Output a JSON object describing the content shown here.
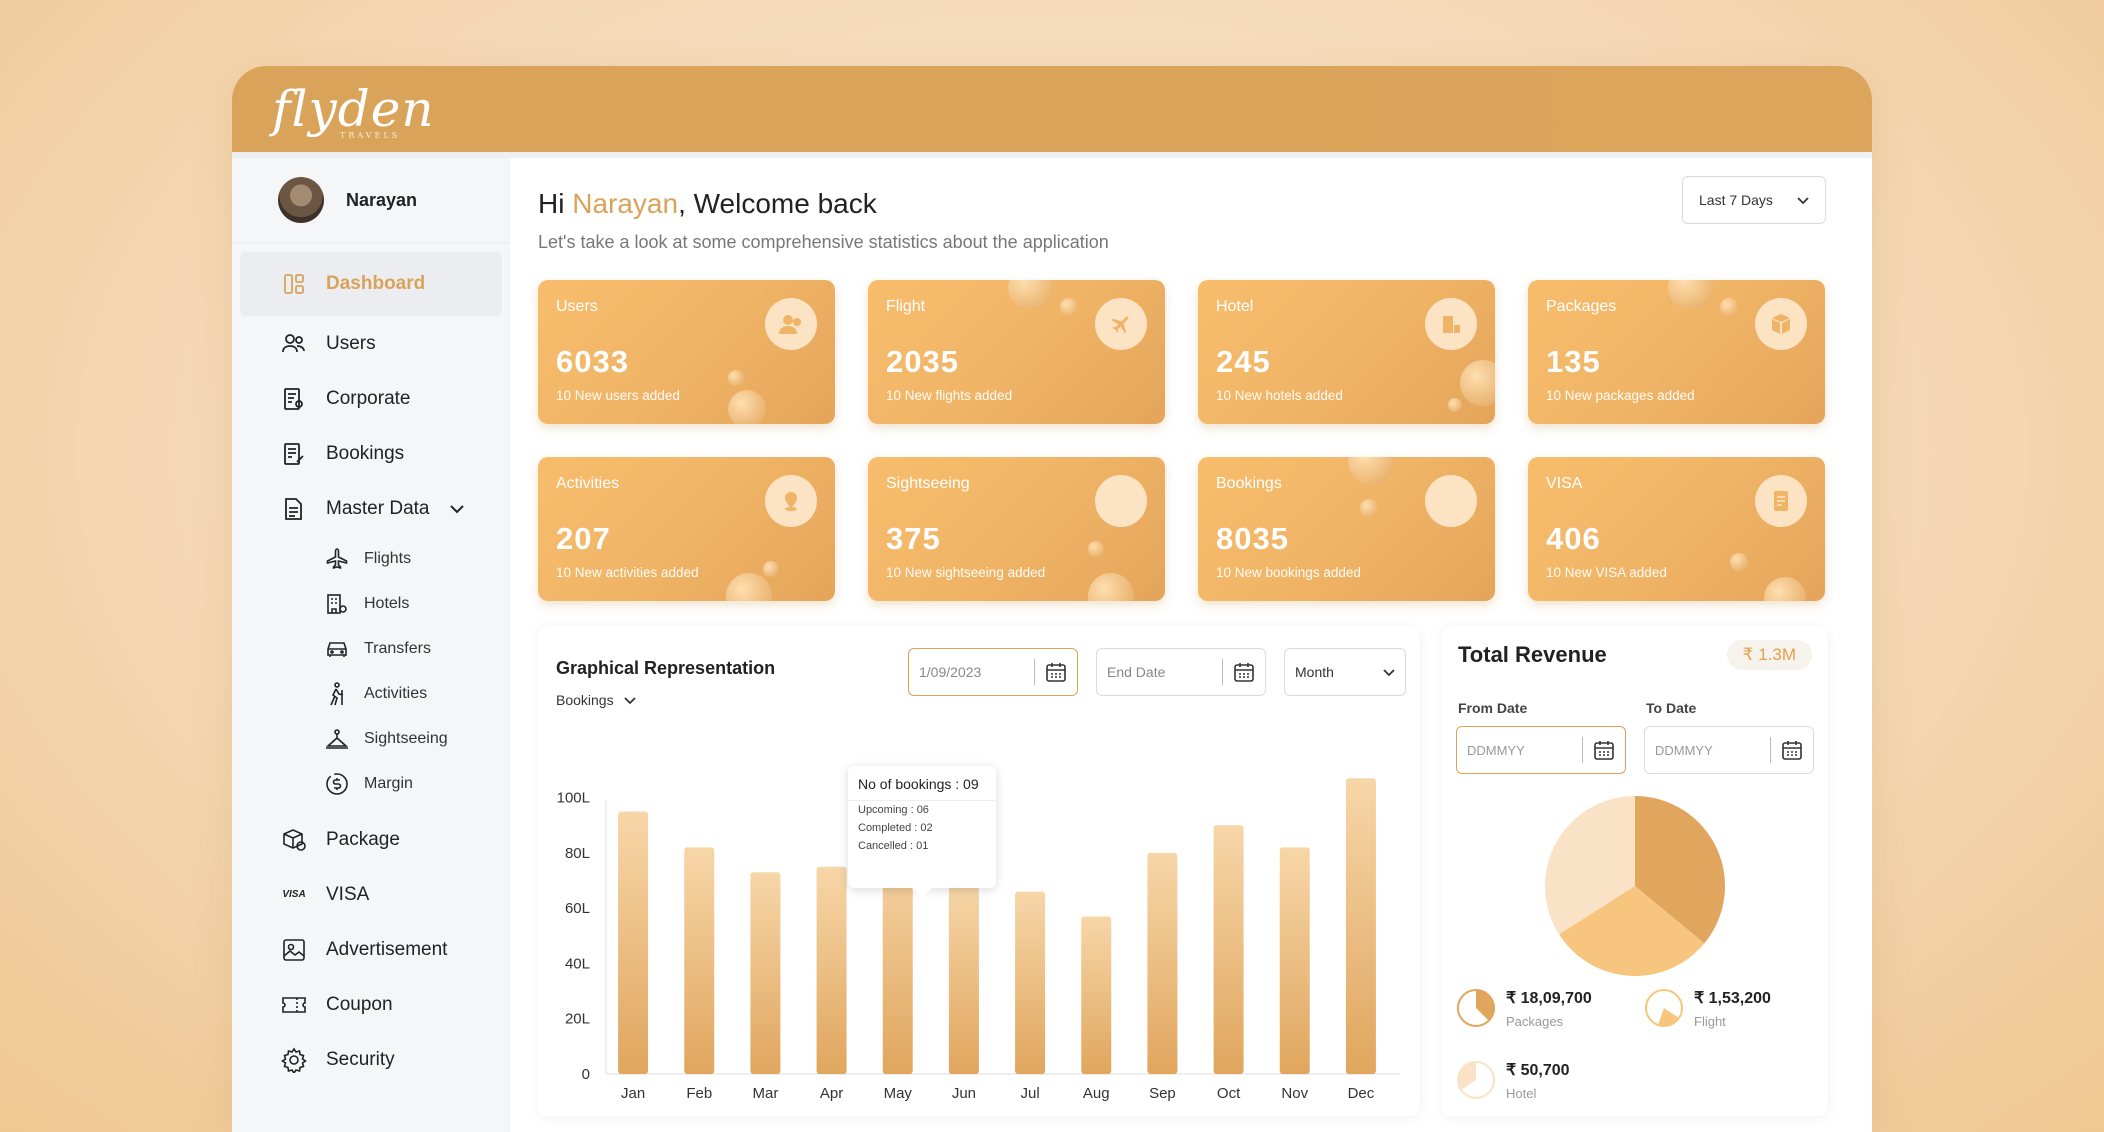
{
  "brand": {
    "logo": "flyden",
    "tagline": "TRAVELS"
  },
  "user": {
    "name": "Narayan"
  },
  "sidebar": {
    "items": [
      {
        "label": "Dashboard",
        "icon": "dashboard-icon"
      },
      {
        "label": "Users",
        "icon": "users-icon"
      },
      {
        "label": "Corporate",
        "icon": "corporate-icon"
      },
      {
        "label": "Bookings",
        "icon": "bookings-icon"
      },
      {
        "label": "Master Data",
        "icon": "master-data-icon"
      }
    ],
    "sub_items": [
      {
        "label": "Flights",
        "icon": "plane-icon"
      },
      {
        "label": "Hotels",
        "icon": "hotel-icon"
      },
      {
        "label": "Transfers",
        "icon": "car-icon"
      },
      {
        "label": "Activities",
        "icon": "hiking-icon"
      },
      {
        "label": "Sightseeing",
        "icon": "sightseeing-icon"
      },
      {
        "label": "Margin",
        "icon": "dollar-icon"
      }
    ],
    "bottom_items": [
      {
        "label": "Package",
        "icon": "package-icon"
      },
      {
        "label": "VISA",
        "icon": "visa-icon"
      },
      {
        "label": "Advertisement",
        "icon": "advertisement-icon"
      },
      {
        "label": "Coupon",
        "icon": "coupon-icon"
      },
      {
        "label": "Security",
        "icon": "gear-icon"
      }
    ]
  },
  "header": {
    "greeting_prefix": "Hi ",
    "greeting_name": "Narayan",
    "greeting_suffix": ", Welcome back",
    "subtitle": "Let's take a look at some comprehensive statistics about the application",
    "range_label": "Last 7 Days"
  },
  "cards": [
    {
      "title": "Users",
      "value": "6033",
      "note": "10 New users added"
    },
    {
      "title": "Flight",
      "value": "2035",
      "note": "10 New flights added"
    },
    {
      "title": "Hotel",
      "value": "245",
      "note": "10 New hotels added"
    },
    {
      "title": "Packages",
      "value": "135",
      "note": "10 New packages added"
    },
    {
      "title": "Activities",
      "value": "207",
      "note": "10 New activities added"
    },
    {
      "title": "Sightseeing",
      "value": "375",
      "note": "10 New sightseeing added"
    },
    {
      "title": "Bookings",
      "value": "8035",
      "note": "10 New bookings added"
    },
    {
      "title": "VISA",
      "value": "406",
      "note": "10 New VISA added"
    }
  ],
  "graph": {
    "title": "Graphical Representation",
    "selector": "Bookings",
    "start_date": "1/09/2023",
    "end_date_placeholder": "End Date",
    "period": "Month",
    "tooltip": {
      "title": "No of bookings : 09",
      "rows": [
        "Upcoming : 06",
        "Completed : 02",
        "Cancelled : 01"
      ]
    }
  },
  "chart_data": {
    "type": "bar",
    "categories": [
      "Jan",
      "Feb",
      "Mar",
      "Apr",
      "May",
      "Jun",
      "Jul",
      "Aug",
      "Sep",
      "Oct",
      "Nov",
      "Dec"
    ],
    "values": [
      95,
      82,
      73,
      75,
      84,
      69,
      66,
      57,
      80,
      90,
      82,
      107
    ],
    "yticks": [
      "0",
      "20L",
      "40L",
      "60L",
      "80L",
      "100L"
    ],
    "ylim": [
      0,
      110
    ],
    "bar_colors": [
      "#f7d6a8",
      "#e0a65e"
    ]
  },
  "revenue": {
    "title": "Total Revenue",
    "badge": "₹ 1.3M",
    "from_label": "From Date",
    "to_label": "To Date",
    "from_placeholder": "DDMMYY",
    "to_placeholder": "DDMMYY",
    "items": [
      {
        "amount": "₹ 18,09,700",
        "label": "Packages"
      },
      {
        "amount": "₹ 1,53,200",
        "label": "Flight"
      },
      {
        "amount": "₹ 50,700",
        "label": "Hotel"
      }
    ],
    "pie": [
      {
        "label": "Packages",
        "value": 36,
        "color": "#e0a65e"
      },
      {
        "label": "Flight",
        "value": 30,
        "color": "#f8c57f"
      },
      {
        "label": "Hotel",
        "value": 34,
        "color": "#f9e2c6"
      }
    ]
  },
  "colors": {
    "accent": "#d9a35a",
    "card": "#f0b466"
  }
}
